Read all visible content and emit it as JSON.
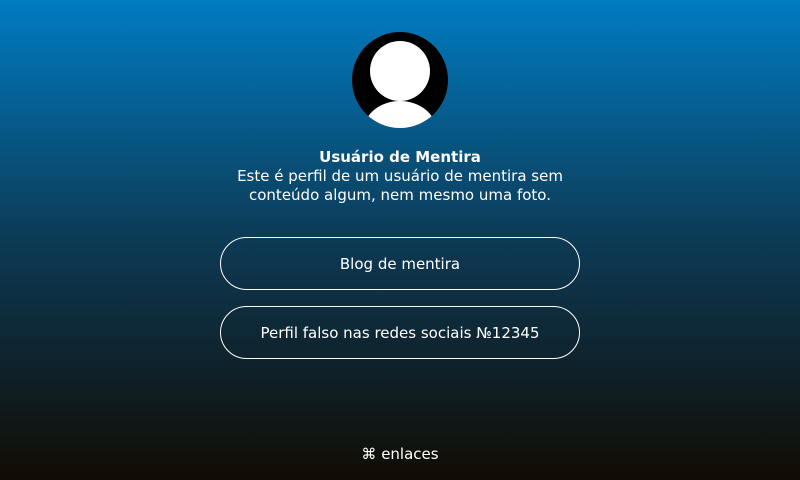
{
  "profile": {
    "avatar_icon": "user-silhouette-icon",
    "name": "Usuário de Mentira",
    "bio": "Este é perfil de um usuário de mentira sem conteúdo algum, nem mesmo uma foto."
  },
  "links": [
    {
      "label": "Blog de mentira"
    },
    {
      "label": "Perfil falso nas redes sociais №12345"
    }
  ],
  "footer": {
    "icon": "command-icon",
    "icon_glyph": "⌘",
    "label": "enlaces"
  },
  "colors": {
    "gradient_top": "#007cc2",
    "gradient_mid": "#0d3a55",
    "gradient_bottom": "#110c03",
    "text": "#ffffff"
  }
}
